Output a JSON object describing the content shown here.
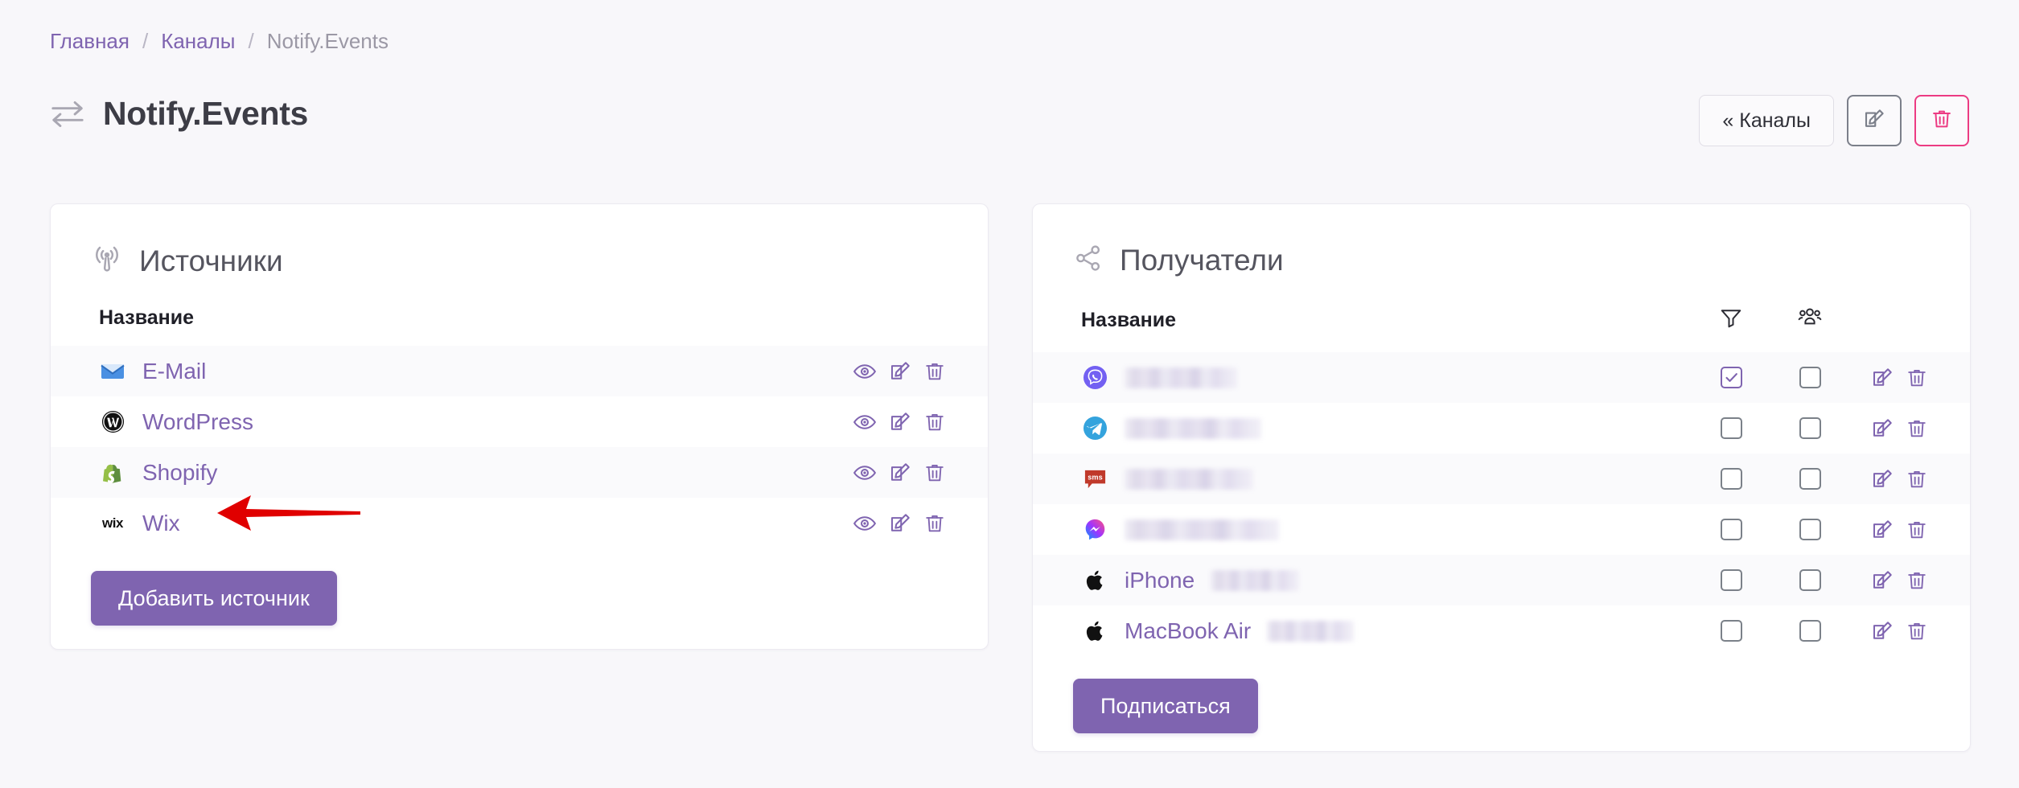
{
  "breadcrumb": {
    "items": [
      {
        "label": "Главная",
        "current": false
      },
      {
        "label": "Каналы",
        "current": false
      },
      {
        "label": "Notify.Events",
        "current": true
      }
    ],
    "separator": "/"
  },
  "header": {
    "title": "Notify.Events",
    "icon": "exchange-arrows-icon",
    "actions": {
      "back_label": "« Каналы",
      "edit_icon": "edit-pencil-icon",
      "delete_icon": "trash-icon",
      "delete_color": "#ec3b83",
      "edit_border_color": "#7b7f8a"
    }
  },
  "theme": {
    "accent": "#7f64b0",
    "link": "#7f64b0",
    "danger": "#ec3b83",
    "page_bg": "#f8f7fa",
    "card_bg": "#ffffff"
  },
  "sources_card": {
    "icon": "broadcast-icon",
    "title": "Источники",
    "columns": {
      "name": "Название",
      "actions": ""
    },
    "rows": [
      {
        "icon": "email-icon",
        "label": "E-Mail"
      },
      {
        "icon": "wordpress-icon",
        "label": "WordPress"
      },
      {
        "icon": "shopify-icon",
        "label": "Shopify"
      },
      {
        "icon": "wix-icon",
        "label": "Wix"
      }
    ],
    "row_actions": [
      "view-eye-icon",
      "edit-pencil-icon",
      "trash-icon"
    ],
    "add_button_label": "Добавить источник"
  },
  "recipients_card": {
    "icon": "share-nodes-icon",
    "title": "Получатели",
    "columns": {
      "name": "Название",
      "filter_icon": "filter-funnel-icon",
      "group_icon": "people-group-icon"
    },
    "rows": [
      {
        "icon": "viber-icon",
        "label": "",
        "redacted": true,
        "redacted_width": 140,
        "filter_checked": true,
        "group_checked": false
      },
      {
        "icon": "telegram-icon",
        "label": "",
        "redacted": true,
        "redacted_width": 170,
        "filter_checked": false,
        "group_checked": false
      },
      {
        "icon": "sms-icon",
        "label": "",
        "redacted": true,
        "redacted_width": 160,
        "filter_checked": false,
        "group_checked": false
      },
      {
        "icon": "messenger-icon",
        "label": "",
        "redacted": true,
        "redacted_width": 192,
        "filter_checked": false,
        "group_checked": false
      },
      {
        "icon": "apple-icon",
        "label": "iPhone",
        "redacted": true,
        "redacted_width": 110,
        "filter_checked": false,
        "group_checked": false
      },
      {
        "icon": "apple-icon",
        "label": "MacBook Air",
        "redacted": true,
        "redacted_width": 108,
        "filter_checked": false,
        "group_checked": false
      }
    ],
    "row_actions": [
      "edit-pencil-icon",
      "trash-icon"
    ],
    "subscribe_button_label": "Подписаться"
  },
  "annotation": {
    "type": "arrow",
    "color": "#e00000",
    "points_to": "Wix",
    "direction": "left"
  }
}
